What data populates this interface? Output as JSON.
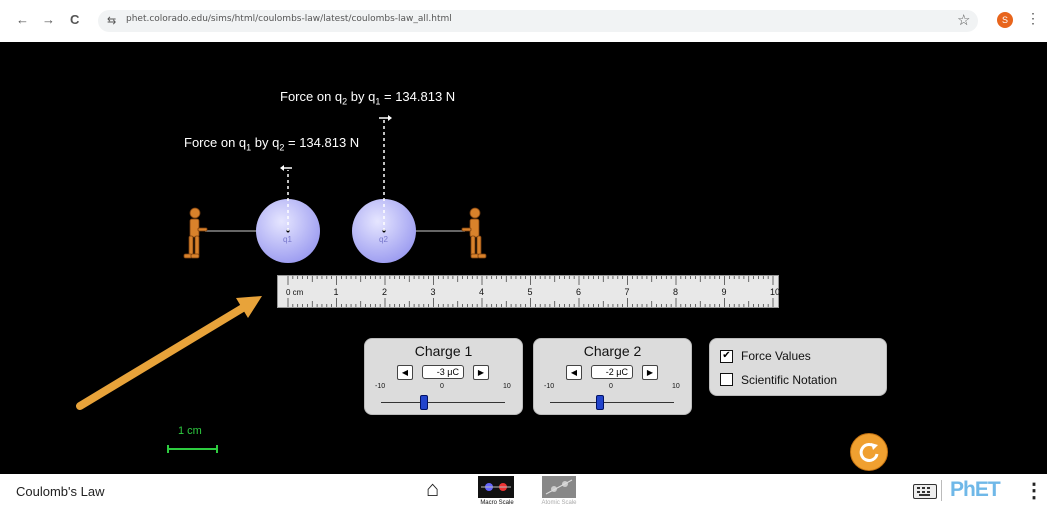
{
  "browser": {
    "back_icon": "←",
    "forward_icon": "→",
    "reload_icon": "C",
    "site_settings_icon": "⇆",
    "url": "phet.colorado.edu/sims/html/coulombs-law/latest/coulombs-law_all.html",
    "bookmark_icon": "☆",
    "profile_initial": "S",
    "menu_icon": "⋮"
  },
  "sim": {
    "force_on_q2": {
      "prefix": "Force on q",
      "sub1": "2",
      "mid": " by q",
      "sub2": "1",
      "value": " = 134.813 N"
    },
    "force_on_q1": {
      "prefix": "Force on q",
      "sub1": "1",
      "mid": " by q",
      "sub2": "2",
      "value": " = 134.813 N"
    },
    "charge_labels": [
      "q1",
      "q2"
    ],
    "ruler": {
      "unit": "0 cm",
      "ticks": [
        "1",
        "2",
        "3",
        "4",
        "5",
        "6",
        "7",
        "8",
        "9",
        "10"
      ]
    },
    "charge1": {
      "title": "Charge 1",
      "value": "-3 μC",
      "min": "-10",
      "mid": "0",
      "max": "10",
      "fraction": 0.35
    },
    "charge2": {
      "title": "Charge 2",
      "value": "-2 μC",
      "min": "-10",
      "mid": "0",
      "max": "10",
      "fraction": 0.4
    },
    "options": {
      "force_values": {
        "label": "Force Values",
        "checked": true,
        "mark": "✔"
      },
      "scientific_notation": {
        "label": "Scientific Notation",
        "checked": false,
        "mark": ""
      }
    },
    "scale_label": "1 cm",
    "reset_icon": "reset-arrow"
  },
  "footer": {
    "title": "Coulomb's Law",
    "home_icon": "⌂",
    "screens": [
      "Macro Scale",
      "Atomic Scale"
    ],
    "logo": "PhET",
    "menu_icon": "⋮"
  },
  "colors": {
    "arrow": "#e8a33a",
    "charge": "#c8c8f8",
    "scale": "#2ecc40",
    "reset": "#f0a030",
    "phet_blue": "#6fb8e8"
  }
}
